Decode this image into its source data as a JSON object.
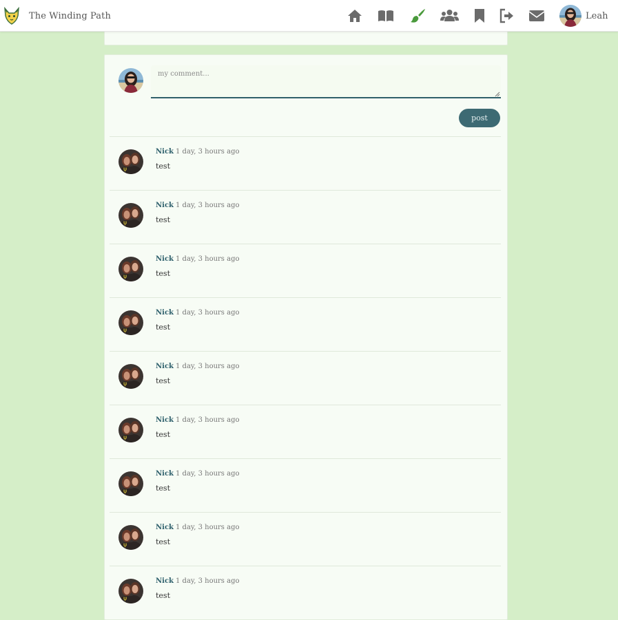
{
  "app": {
    "title": "The Winding Path"
  },
  "user": {
    "name": "Leah"
  },
  "nav": {
    "icons": [
      "home-icon",
      "book-icon",
      "brush-icon",
      "users-icon",
      "bookmark-icon",
      "sign-out-icon",
      "envelope-icon"
    ],
    "active": "brush-icon",
    "active_color": "#4a9a3c",
    "icon_color": "#6b6b6b"
  },
  "composer": {
    "placeholder": "my comment...",
    "value": "",
    "post_label": "post"
  },
  "comments": [
    {
      "author": "Nick",
      "time": "1 day, 3 hours ago",
      "text": "test"
    },
    {
      "author": "Nick",
      "time": "1 day, 3 hours ago",
      "text": "test"
    },
    {
      "author": "Nick",
      "time": "1 day, 3 hours ago",
      "text": "test"
    },
    {
      "author": "Nick",
      "time": "1 day, 3 hours ago",
      "text": "test"
    },
    {
      "author": "Nick",
      "time": "1 day, 3 hours ago",
      "text": "test"
    },
    {
      "author": "Nick",
      "time": "1 day, 3 hours ago",
      "text": "test"
    },
    {
      "author": "Nick",
      "time": "1 day, 3 hours ago",
      "text": "test"
    },
    {
      "author": "Nick",
      "time": "1 day, 3 hours ago",
      "text": "test"
    },
    {
      "author": "Nick",
      "time": "1 day, 3 hours ago",
      "text": "test"
    }
  ],
  "colors": {
    "background": "#d5eec8",
    "accent": "#3d6a73",
    "link": "#2d5f6b"
  }
}
